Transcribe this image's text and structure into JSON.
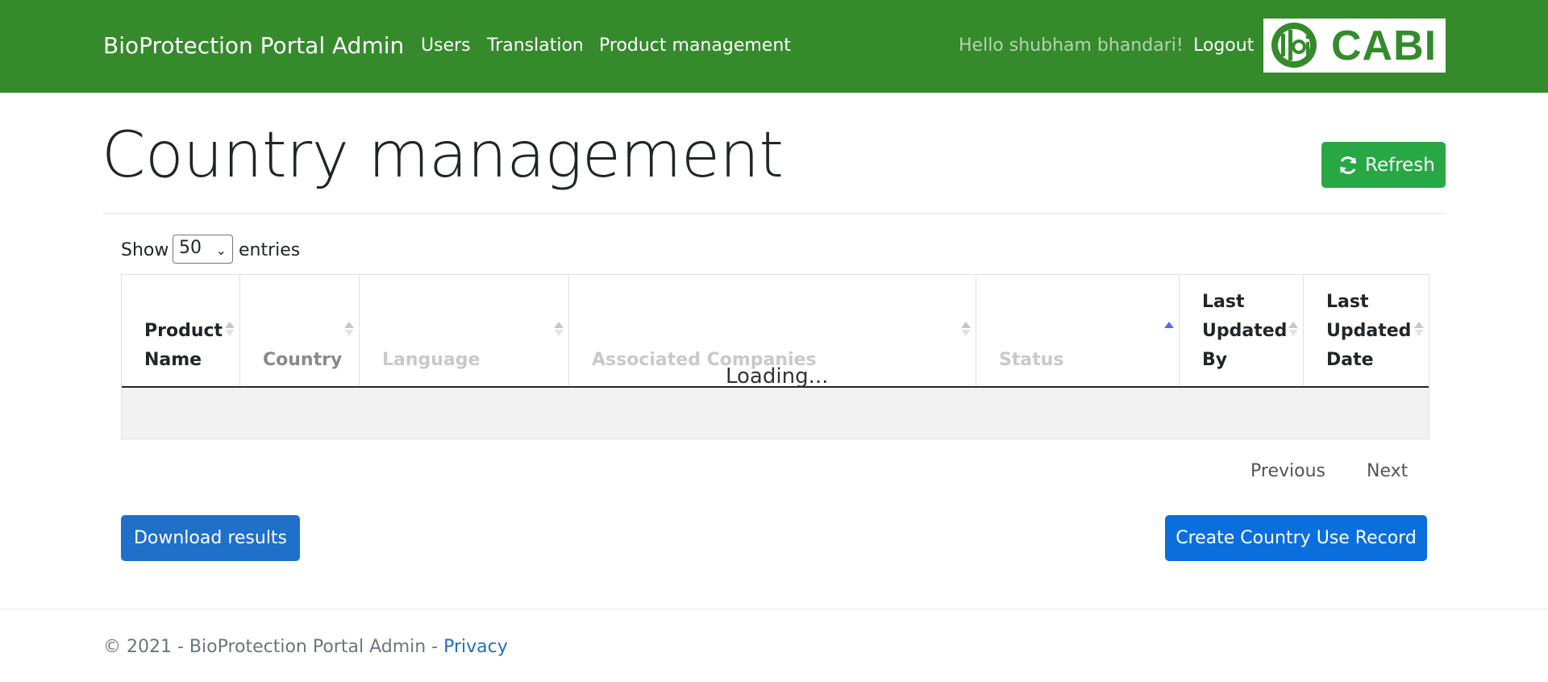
{
  "navbar": {
    "brand": "BioProtection Portal Admin",
    "links": [
      "Users",
      "Translation",
      "Product management"
    ],
    "greeting": "Hello shubham bhandari!",
    "logout": "Logout",
    "logo_text": "CABI",
    "bg_color": "#358a2c"
  },
  "page": {
    "title": "Country management",
    "refresh_label": "Refresh"
  },
  "table_controls": {
    "show_label": "Show",
    "entries_value": "50",
    "entries_label": "entries"
  },
  "table": {
    "columns": [
      "Product\nName",
      "Country",
      "Language",
      "Associated Companies",
      "Status",
      "Last\nUpdated\nBy",
      "Last\nUpdated\nDate"
    ],
    "sorted_column": "Status",
    "loading_text": "Loading..."
  },
  "pagination": {
    "previous": "Previous",
    "next": "Next"
  },
  "actions": {
    "download": "Download results",
    "create": "Create Country Use Record"
  },
  "footer": {
    "copyright": "© 2021 - BioProtection Portal Admin - ",
    "privacy": "Privacy"
  }
}
